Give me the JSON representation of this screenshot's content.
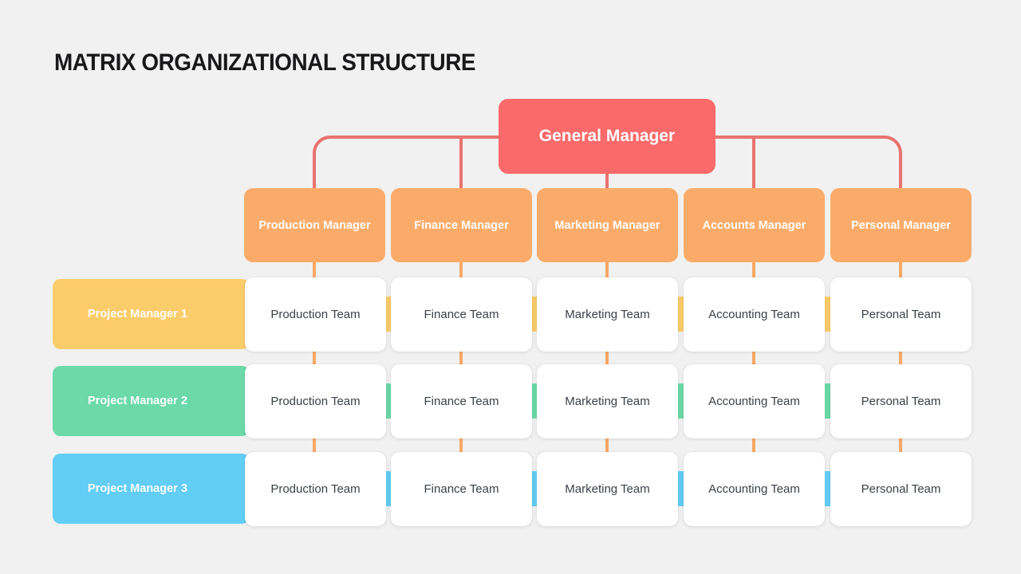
{
  "title": "MATRIX ORGANIZATIONAL STRUCTURE",
  "colors": {
    "background": "#f1f1f1",
    "title_text": "#18181a",
    "general_manager": "#fa6a6a",
    "general_manager_connector": "#e8736f",
    "manager": "#fbab69",
    "manager_connector": "#f9a865",
    "row_1": "#fbcc6a",
    "row_2": "#6bd9a8",
    "row_3": "#62cdf5",
    "card_background": "#ffffff",
    "card_text": "#3b4049",
    "node_text": "#ffffff"
  },
  "root": {
    "label": "General Manager"
  },
  "managers": [
    {
      "label": "Production Manager"
    },
    {
      "label": "Finance Manager"
    },
    {
      "label": "Marketing Manager"
    },
    {
      "label": "Accounts Manager"
    },
    {
      "label": "Personal Manager"
    }
  ],
  "rows": [
    {
      "label": "Project Manager 1",
      "color": "#fbcc6a",
      "teams": [
        {
          "label": "Production Team"
        },
        {
          "label": "Finance Team"
        },
        {
          "label": "Marketing Team"
        },
        {
          "label": "Accounting Team"
        },
        {
          "label": "Personal Team"
        }
      ]
    },
    {
      "label": "Project Manager 2",
      "color": "#6bd9a8",
      "teams": [
        {
          "label": "Production Team"
        },
        {
          "label": "Finance Team"
        },
        {
          "label": "Marketing Team"
        },
        {
          "label": "Accounting Team"
        },
        {
          "label": "Personal Team"
        }
      ]
    },
    {
      "label": "Project Manager 3",
      "color": "#62cdf5",
      "teams": [
        {
          "label": "Production Team"
        },
        {
          "label": "Finance Team"
        },
        {
          "label": "Marketing Team"
        },
        {
          "label": "Accounting Team"
        },
        {
          "label": "Personal Team"
        }
      ]
    }
  ]
}
